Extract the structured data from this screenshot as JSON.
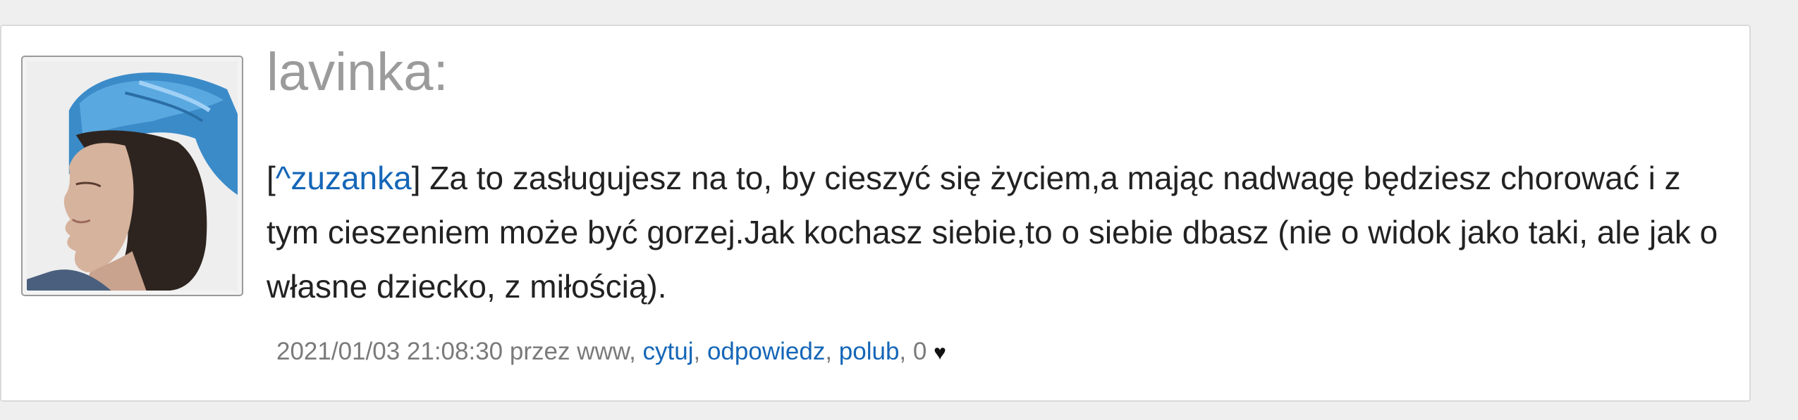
{
  "post": {
    "author_label": "lavinka:",
    "mention": "^zuzanka",
    "bracket_open": "[",
    "bracket_close": "]",
    "body_text": " Za to zasługujesz na to, by cieszyć się życiem,a mając nadwagę będziesz chorować i z tym cieszeniem może być gorzej.Jak kochasz siebie,to o siebie dbasz (nie o widok jako taki, ale jak o własne dziecko, z miłością).",
    "meta": {
      "timestamp_text": "2021/01/03 21:08:30 przez www,",
      "quote_label": "cytuj",
      "reply_label": "odpowiedz",
      "like_label": "polub",
      "like_count": "0",
      "sep": ",",
      "heart_icon": "♥"
    }
  },
  "colors": {
    "link": "#1566b7",
    "author": "#9b9b9b",
    "background": "#efefef"
  }
}
